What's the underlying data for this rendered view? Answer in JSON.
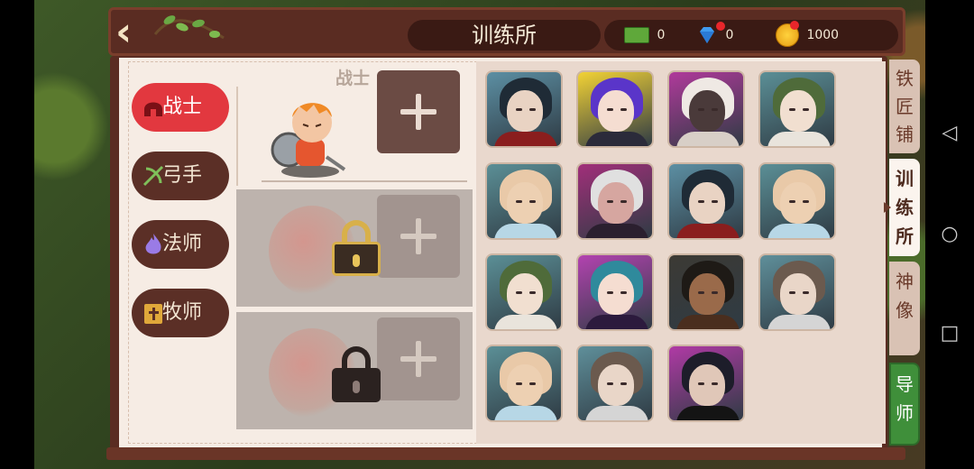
{
  "header": {
    "title": "训练所",
    "resources": [
      {
        "name": "cash",
        "icon": "cash-icon",
        "value": "0"
      },
      {
        "name": "diamond",
        "icon": "diamond-icon",
        "value": "0"
      },
      {
        "name": "gold",
        "icon": "gold-coin-icon",
        "value": "1000"
      }
    ]
  },
  "class_tabs": [
    {
      "label": "战士",
      "icon": "warrior-helmet-icon",
      "active": true
    },
    {
      "label": "弓手",
      "icon": "bow-icon",
      "active": false
    },
    {
      "label": "法师",
      "icon": "flame-icon",
      "active": false
    },
    {
      "label": "牧师",
      "icon": "holy-book-icon",
      "active": false
    }
  ],
  "slots": {
    "active_slot_title": "战士",
    "locked_slot_1_name": "",
    "locked_slot_2_name": ""
  },
  "side_tabs": [
    {
      "label": "铁匠铺",
      "active": false
    },
    {
      "label": "训练所",
      "active": true
    },
    {
      "label": "神像",
      "active": false
    },
    {
      "label": "导师",
      "active": false
    }
  ],
  "colors": {
    "active_tab": "#e2383f",
    "inactive_tab": "#5b2f26",
    "mentor_tab": "#3f8f3a",
    "panel": "#f6ece4"
  },
  "heroes": [
    {
      "portrait": "dark-haired-swordsman",
      "bg": "#5c8fa3",
      "hair": "#1f2b36",
      "skin": "#e9d3c3",
      "cloth": "#8a1e1e"
    },
    {
      "portrait": "purple-haired-girl",
      "bg": "#f2d235",
      "hair": "#5a35c9",
      "skin": "#f5ddd1",
      "cloth": "#2b2b3a"
    },
    {
      "portrait": "white-haired-dark-elf",
      "bg": "#b03a9b",
      "hair": "#efe9e4",
      "skin": "#4a3a3a",
      "cloth": "#d8cfc7"
    },
    {
      "portrait": "green-haired-lady",
      "bg": "#5b8f96",
      "hair": "#4f6b3a",
      "skin": "#f1dfd0",
      "cloth": "#e9e4dc"
    },
    {
      "portrait": "bald-monk",
      "bg": "#5b8f96",
      "hair": "#e9c9a8",
      "skin": "#edd0b2",
      "cloth": "#b7d7e6"
    },
    {
      "portrait": "white-haired-demon",
      "bg": "#a12f7a",
      "hair": "#e0e0e0",
      "skin": "#d6a6a0",
      "cloth": "#2b1f2f"
    },
    {
      "portrait": "dark-haired-swordsman",
      "bg": "#5c8fa3",
      "hair": "#1f2b36",
      "skin": "#e9d3c3",
      "cloth": "#8a1e1e"
    },
    {
      "portrait": "bald-monk",
      "bg": "#5b8f96",
      "hair": "#e9c9a8",
      "skin": "#edd0b2",
      "cloth": "#b7d7e6"
    },
    {
      "portrait": "green-haired-lady",
      "bg": "#5b8f96",
      "hair": "#4f6b3a",
      "skin": "#f1dfd0",
      "cloth": "#e9e4dc"
    },
    {
      "portrait": "teal-haired-witch",
      "bg": "#b343b0",
      "hair": "#2f8a9c",
      "skin": "#f5ddd1",
      "cloth": "#2c1a3d"
    },
    {
      "portrait": "bearded-warrior",
      "bg": "#3c3a34",
      "hair": "#1e1a16",
      "skin": "#9a6a4a",
      "cloth": "#4a2e1e"
    },
    {
      "portrait": "curly-haired-nun",
      "bg": "#5f8f9a",
      "hair": "#6b5a4e",
      "skin": "#e9d6c8",
      "cloth": "#d5d5d5"
    },
    {
      "portrait": "bald-monk",
      "bg": "#5b8f96",
      "hair": "#e9c9a8",
      "skin": "#edd0b2",
      "cloth": "#b7d7e6"
    },
    {
      "portrait": "curly-haired-nun",
      "bg": "#5f8f9a",
      "hair": "#6b5a4e",
      "skin": "#e9d6c8",
      "cloth": "#d5d5d5"
    },
    {
      "portrait": "masked-ninja-girl",
      "bg": "#b03aa5",
      "hair": "#1d1d2a",
      "skin": "#e0c7b8",
      "cloth": "#141414"
    }
  ]
}
